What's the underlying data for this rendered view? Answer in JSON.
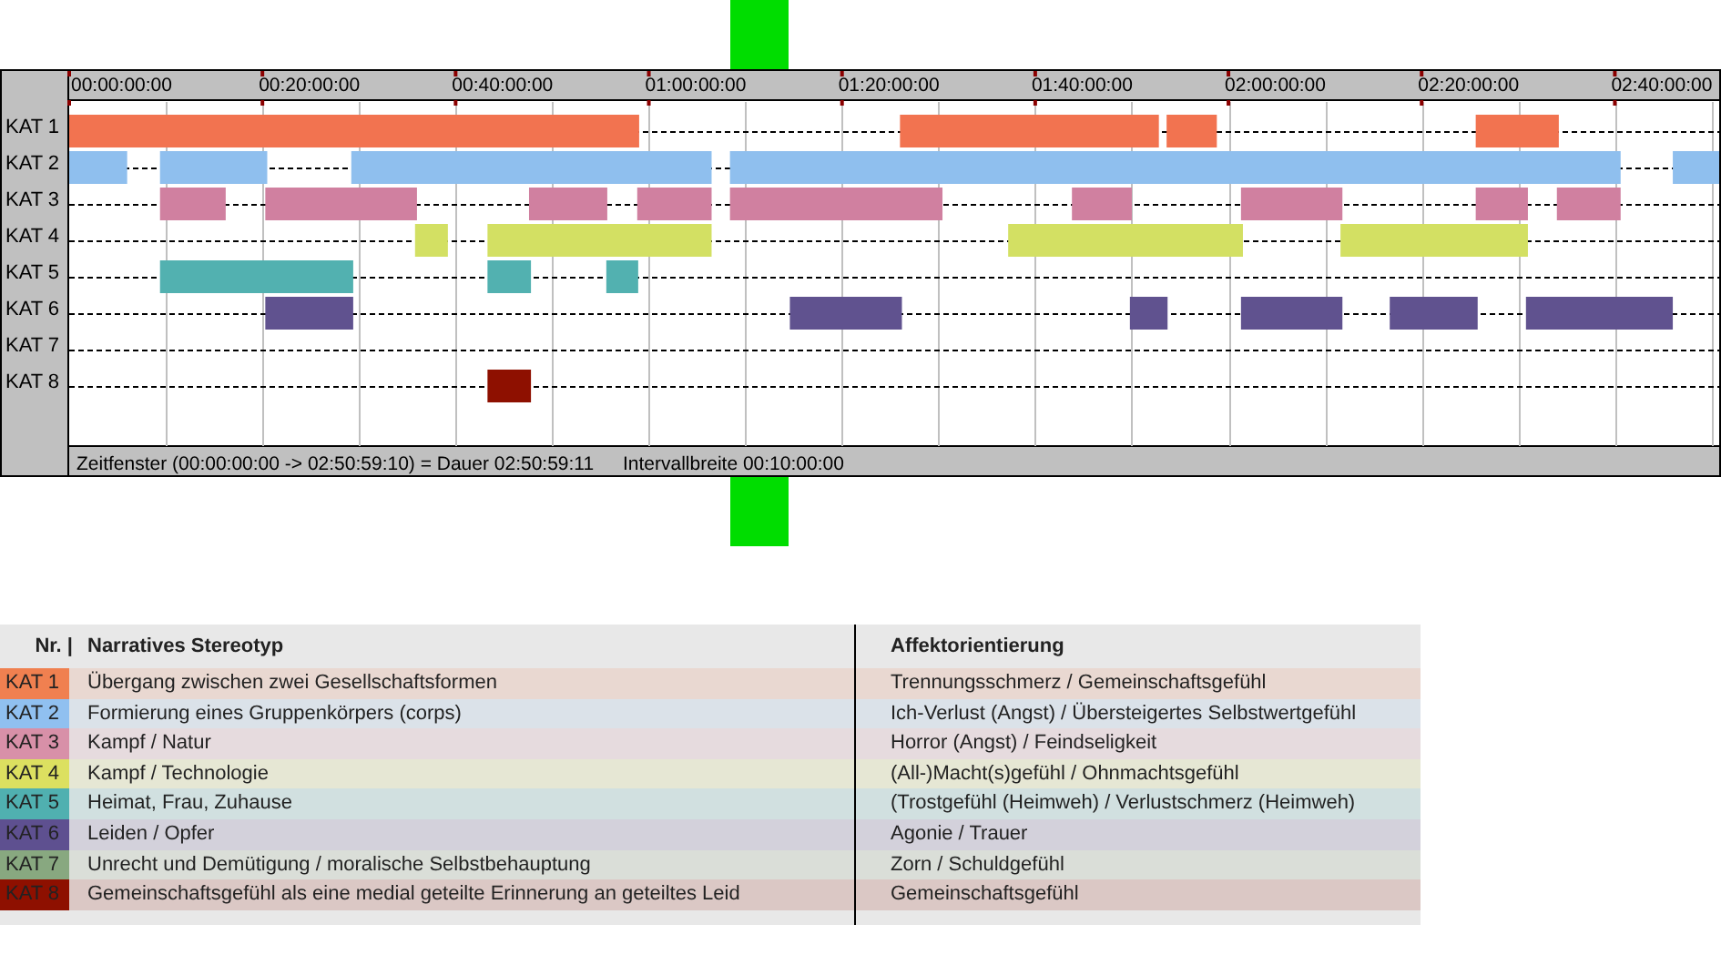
{
  "timeline": {
    "playhead": {
      "level": 0.418
    },
    "time_labels": [
      "00:00:00:00",
      "00:20:00:00",
      "00:40:00:00",
      "01:00:00:00",
      "01:20:00:00",
      "01:40:00:00",
      "02:00:00:00",
      "02:20:00:00",
      "02:40:00:00"
    ],
    "tracks": [
      {
        "label": "KAT 1",
        "color": "#f27350"
      },
      {
        "label": "KAT 2",
        "color": "#8fbfee"
      },
      {
        "label": "KAT 3",
        "color": "#d080a0"
      },
      {
        "label": "KAT 4",
        "color": "#d3e063"
      },
      {
        "label": "KAT 5",
        "color": "#52b1b0"
      },
      {
        "label": "KAT 6",
        "color": "#60528f"
      },
      {
        "label": "KAT 7"
      },
      {
        "label": "KAT 8",
        "color": "#8e1000"
      }
    ],
    "footer": [
      "Zeitfenster (00:00:00:00 -> 02:50:59:10) = Dauer 02:50:59:11",
      "Intervallbreite 00:10:00:00"
    ]
  },
  "legend": {
    "columns": [
      "Nr. |",
      "Narratives Stereotyp",
      "Affektorientierung"
    ],
    "rows": [
      {
        "nr": "KAT 1",
        "color": "#f08050",
        "stereotype": "Übergang zwischen zwei Gesellschaftsformen",
        "affect": "Trennungsschmerz / Gemeinschaftsgefühl"
      },
      {
        "nr": "KAT 2",
        "color": "#90c0f0",
        "stereotype": "Formierung eines Gruppenkörpers (corps)",
        "affect": "Ich-Verlust (Angst) / Übersteigertes Selbstwertgefühl"
      },
      {
        "nr": "KAT 3",
        "color": "#d890a8",
        "stereotype": "Kampf / Natur",
        "affect": "Horror (Angst) / Feindseligkeit"
      },
      {
        "nr": "KAT 4",
        "color": "#dce060",
        "stereotype": "Kampf / Technologie",
        "affect": "(All-)Macht(s)gefühl / Ohnmachtsgefühl"
      },
      {
        "nr": "KAT 5",
        "color": "#50b0b0",
        "stereotype": "Heimat, Frau, Zuhause",
        "affect": "(Trostgefühl (Heimweh) / Verlustschmerz (Heimweh)"
      },
      {
        "nr": "KAT 6",
        "color": "#5e5090",
        "stereotype": "Leiden / Opfer",
        "affect": "Agonie / Trauer"
      },
      {
        "nr": "KAT 7",
        "color": "#88a880",
        "stereotype": "Unrecht und Demütigung / moralische Selbstbehauptung",
        "affect": "Zorn / Schuldgefühl"
      },
      {
        "nr": "KAT 8",
        "color": "#8e1000",
        "stereotype": "Gemeinschaftsgefühl als eine medial geteilte Erinnerung an geteiltes Leid",
        "affect": "Gemeinschaftsgefühl"
      }
    ]
  }
}
